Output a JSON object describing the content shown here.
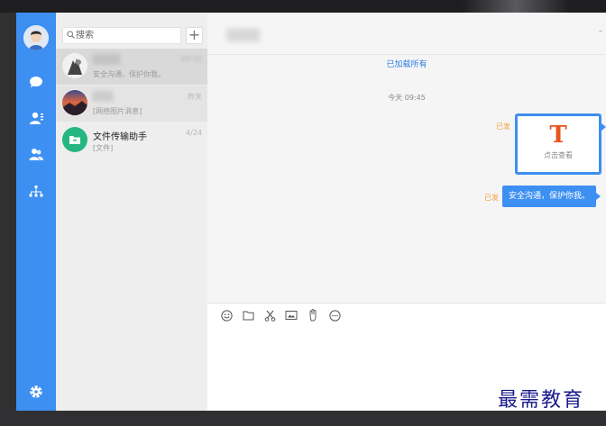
{
  "search": {
    "placeholder": "搜索"
  },
  "conversations": [
    {
      "name": "░░░░",
      "preview": "安全沟通，保护你我。",
      "time": "09:45"
    },
    {
      "name": "░░░",
      "preview": "[网络图片消息]",
      "time": "昨天"
    },
    {
      "name": "文件传输助手",
      "preview": "[文件]",
      "time": "4/24"
    }
  ],
  "chat": {
    "title": "░░░░",
    "load_all": "已加载所有",
    "time_separator": "今天 09:45",
    "messages": [
      {
        "status": "已发",
        "file_letter": "T",
        "file_hint": "点击查看"
      },
      {
        "status": "已发",
        "text": "安全沟通，保护你我。"
      }
    ]
  },
  "watermark": "最需教育",
  "colors": {
    "accent": "#3d8ff2",
    "status": "#f0a53e",
    "file_icon": "#e8531e",
    "file_transfer_green": "#25b681"
  },
  "icons": {
    "rail": [
      "chat-icon",
      "contacts-icon",
      "group-icon",
      "org-chart-icon",
      "settings-icon"
    ],
    "toolbar": [
      "emoji-icon",
      "folder-icon",
      "scissors-icon",
      "screenshot-icon",
      "shake-icon",
      "more-icon"
    ]
  }
}
